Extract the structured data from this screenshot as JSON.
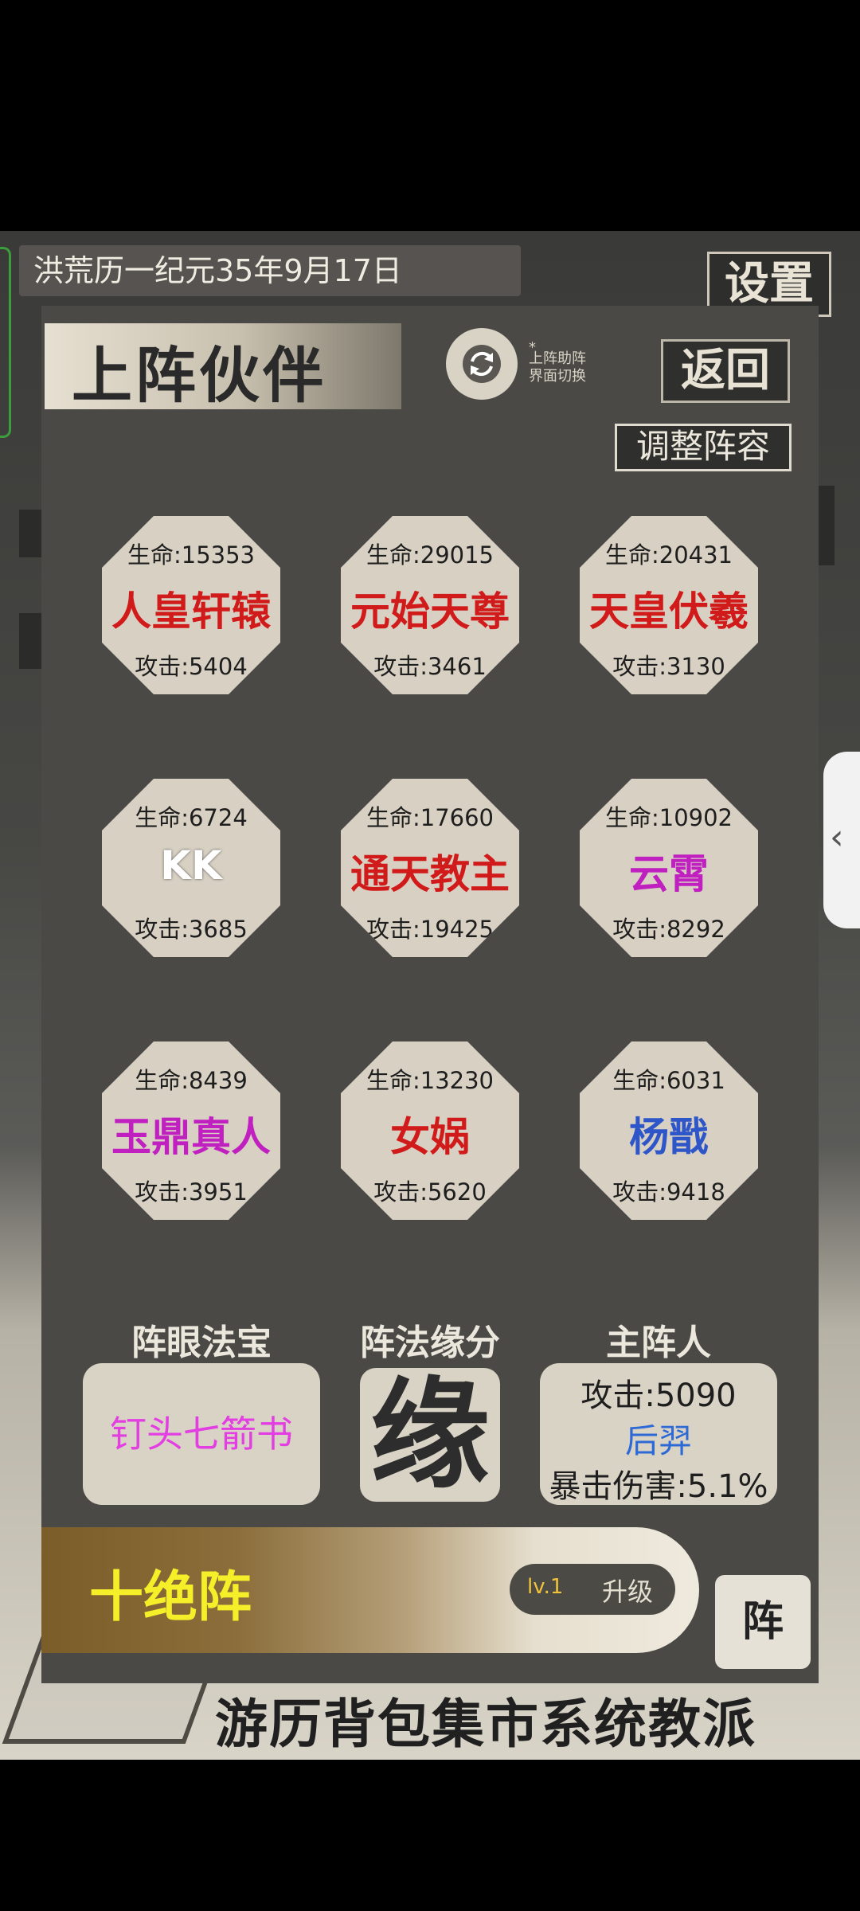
{
  "background": {
    "date_text": "洪荒历一纪元35年9月17日",
    "settings_label": "设置",
    "bottom_nav": "游历背包集市系统教派"
  },
  "panel": {
    "title": "上阵伙伴",
    "switch_note_star": "*",
    "switch_note_line1": "上阵助阵",
    "switch_note_line2": "界面切换",
    "back_label": "返回",
    "adjust_label": "调整阵容"
  },
  "partners": [
    {
      "hp": "生命:15353",
      "name": "人皇轩辕",
      "atk": "攻击:5404",
      "color": "#d11b1b"
    },
    {
      "hp": "生命:29015",
      "name": "元始天尊",
      "atk": "攻击:3461",
      "color": "#d11b1b"
    },
    {
      "hp": "生命:20431",
      "name": "天皇伏羲",
      "atk": "攻击:3130",
      "color": "#d11b1b"
    },
    {
      "hp": "生命:6724",
      "name": "KK",
      "atk": "攻击:3685",
      "color": "#ffffff"
    },
    {
      "hp": "生命:17660",
      "name": "通天教主",
      "atk": "攻击:19425",
      "color": "#d11b1b"
    },
    {
      "hp": "生命:10902",
      "name": "云霄",
      "atk": "攻击:8292",
      "color": "#c020c0"
    },
    {
      "hp": "生命:8439",
      "name": "玉鼎真人",
      "atk": "攻击:3951",
      "color": "#c020c0"
    },
    {
      "hp": "生命:13230",
      "name": "女娲",
      "atk": "攻击:5620",
      "color": "#d11b1b"
    },
    {
      "hp": "生命:6031",
      "name": "杨戬",
      "atk": "攻击:9418",
      "color": "#2e56c8"
    }
  ],
  "sections": {
    "treasure_label": "阵眼法宝",
    "treasure_value": "钉头七箭书",
    "fate_label": "阵法缘分",
    "fate_glyph": "缘",
    "leader_label": "主阵人",
    "leader_attack": "攻击:5090",
    "leader_name": "后羿",
    "leader_crit": "暴击伤害:5.1%"
  },
  "formation": {
    "name": "十绝阵",
    "level": "lv.1",
    "upgrade_label": "升级",
    "zhen_label": "阵"
  }
}
